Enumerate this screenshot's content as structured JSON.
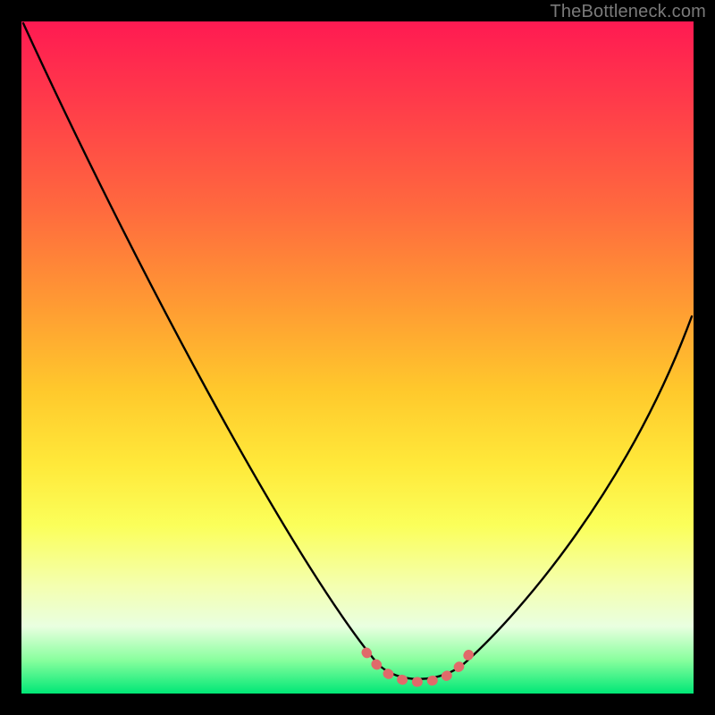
{
  "watermark": "TheBottleneck.com",
  "colors": {
    "background_frame": "#000000",
    "gradient_top": "#ff1a52",
    "gradient_bottom": "#00e776",
    "curve_stroke": "#000000",
    "trough_marker": "#e06a6a"
  },
  "chart_data": {
    "type": "line",
    "title": "",
    "xlabel": "",
    "ylabel": "",
    "xlim": [
      0,
      100
    ],
    "ylim": [
      0,
      1
    ],
    "grid": false,
    "series": [
      {
        "name": "bottleneck-curve",
        "x": [
          0,
          8,
          16,
          24,
          32,
          40,
          48,
          54,
          58,
          62,
          66,
          70,
          78,
          86,
          94,
          100
        ],
        "values": [
          1.0,
          0.85,
          0.71,
          0.56,
          0.42,
          0.28,
          0.13,
          0.04,
          0.01,
          0.01,
          0.04,
          0.08,
          0.2,
          0.33,
          0.46,
          0.56
        ]
      },
      {
        "name": "trough-marker",
        "x": [
          52,
          54,
          56,
          58,
          60,
          62,
          64,
          66
        ],
        "values": [
          0.05,
          0.03,
          0.02,
          0.01,
          0.01,
          0.02,
          0.03,
          0.05
        ]
      }
    ],
    "annotations": []
  }
}
